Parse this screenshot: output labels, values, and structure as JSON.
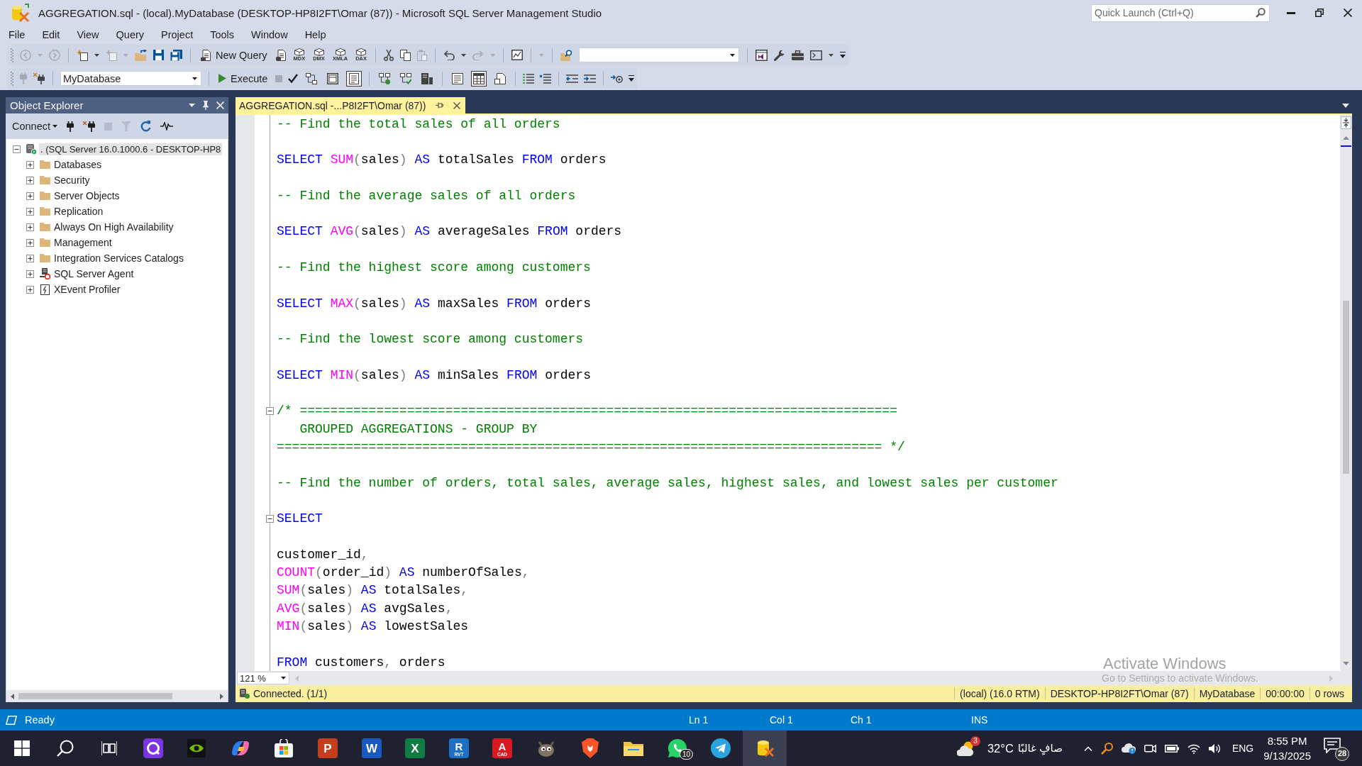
{
  "window": {
    "title": "AGGREGATION.sql - (local).MyDatabase (DESKTOP-HP8I2FT\\Omar (87)) - Microsoft SQL Server Management Studio",
    "quick_launch": {
      "placeholder": "Quick Launch (Ctrl+Q)"
    }
  },
  "menu": [
    "File",
    "Edit",
    "View",
    "Query",
    "Project",
    "Tools",
    "Window",
    "Help"
  ],
  "toolbar_1": {
    "new_query": "New Query",
    "query_types": [
      "MDX",
      "DMX",
      "XMLA",
      "DAX"
    ]
  },
  "toolbar_2": {
    "database": "MyDatabase",
    "execute": "Execute",
    "toggles": [
      {
        "on": false
      },
      {
        "on": false
      },
      {
        "on": true
      },
      {
        "on": false
      },
      {
        "on": false
      },
      {
        "on": false
      }
    ],
    "result_modes": [
      {
        "selected": false
      },
      {
        "selected": true
      },
      {
        "selected": false
      }
    ]
  },
  "object_explorer": {
    "title": "Object Explorer",
    "connect": "Connect",
    "tree": [
      {
        "label": ". (SQL Server 16.0.1000.6 - DESKTOP-HP8",
        "kind": "server",
        "expanded": true,
        "selected": true,
        "children": [
          {
            "label": "Databases",
            "kind": "folder",
            "expanded": false,
            "selected": false
          },
          {
            "label": "Security",
            "kind": "folder",
            "expanded": false,
            "selected": false
          },
          {
            "label": "Server Objects",
            "kind": "folder",
            "expanded": false,
            "selected": false
          },
          {
            "label": "Replication",
            "kind": "folder",
            "expanded": false,
            "selected": false
          },
          {
            "label": "Always On High Availability",
            "kind": "folder",
            "expanded": false,
            "selected": false
          },
          {
            "label": "Management",
            "kind": "folder",
            "expanded": false,
            "selected": false
          },
          {
            "label": "Integration Services Catalogs",
            "kind": "folder",
            "expanded": false,
            "selected": false
          },
          {
            "label": "SQL Server Agent",
            "kind": "agent",
            "expanded": false,
            "selected": false
          },
          {
            "label": "XEvent Profiler",
            "kind": "profiler",
            "expanded": false,
            "selected": false
          }
        ]
      }
    ]
  },
  "editor": {
    "tab": {
      "title": "AGGREGATION.sql -...P8I2FT\\Omar (87))",
      "selected": true
    },
    "lines": [
      {
        "kind": "code",
        "tokens": [
          {
            "kind": "comment",
            "text": "-- Find the total sales of all orders"
          }
        ]
      },
      {
        "kind": "blank"
      },
      {
        "kind": "code",
        "tokens": [
          {
            "kind": "keyword",
            "text": "SELECT "
          },
          {
            "kind": "function",
            "text": "SUM"
          },
          {
            "kind": "punct",
            "text": "("
          },
          {
            "kind": "plain",
            "text": "sales"
          },
          {
            "kind": "punct",
            "text": ") "
          },
          {
            "kind": "keyword",
            "text": "AS"
          },
          {
            "kind": "plain",
            "text": " totalSales "
          },
          {
            "kind": "keyword",
            "text": "FROM"
          },
          {
            "kind": "plain",
            "text": " orders"
          }
        ]
      },
      {
        "kind": "blank"
      },
      {
        "kind": "code",
        "tokens": [
          {
            "kind": "comment",
            "text": "-- Find the average sales of all orders"
          }
        ]
      },
      {
        "kind": "blank"
      },
      {
        "kind": "code",
        "tokens": [
          {
            "kind": "keyword",
            "text": "SELECT "
          },
          {
            "kind": "function",
            "text": "AVG"
          },
          {
            "kind": "punct",
            "text": "("
          },
          {
            "kind": "plain",
            "text": "sales"
          },
          {
            "kind": "punct",
            "text": ") "
          },
          {
            "kind": "keyword",
            "text": "AS"
          },
          {
            "kind": "plain",
            "text": " averageSales "
          },
          {
            "kind": "keyword",
            "text": "FROM"
          },
          {
            "kind": "plain",
            "text": " orders"
          }
        ]
      },
      {
        "kind": "blank"
      },
      {
        "kind": "code",
        "tokens": [
          {
            "kind": "comment",
            "text": "-- Find the highest score among customers"
          }
        ]
      },
      {
        "kind": "blank"
      },
      {
        "kind": "code",
        "tokens": [
          {
            "kind": "keyword",
            "text": "SELECT "
          },
          {
            "kind": "function",
            "text": "MAX"
          },
          {
            "kind": "punct",
            "text": "("
          },
          {
            "kind": "plain",
            "text": "sales"
          },
          {
            "kind": "punct",
            "text": ") "
          },
          {
            "kind": "keyword",
            "text": "AS"
          },
          {
            "kind": "plain",
            "text": " maxSales "
          },
          {
            "kind": "keyword",
            "text": "FROM"
          },
          {
            "kind": "plain",
            "text": " orders"
          }
        ]
      },
      {
        "kind": "blank"
      },
      {
        "kind": "code",
        "tokens": [
          {
            "kind": "comment",
            "text": "-- Find the lowest score among customers"
          }
        ]
      },
      {
        "kind": "blank"
      },
      {
        "kind": "code",
        "tokens": [
          {
            "kind": "keyword",
            "text": "SELECT "
          },
          {
            "kind": "function",
            "text": "MIN"
          },
          {
            "kind": "punct",
            "text": "("
          },
          {
            "kind": "plain",
            "text": "sales"
          },
          {
            "kind": "punct",
            "text": ") "
          },
          {
            "kind": "keyword",
            "text": "AS"
          },
          {
            "kind": "plain",
            "text": " minSales "
          },
          {
            "kind": "keyword",
            "text": "FROM"
          },
          {
            "kind": "plain",
            "text": " orders"
          }
        ]
      },
      {
        "kind": "blank"
      },
      {
        "kind": "fold",
        "expanded": true,
        "tokens": [
          {
            "kind": "comment",
            "text": "/* =============================================================================="
          }
        ]
      },
      {
        "kind": "code",
        "tokens": [
          {
            "kind": "comment",
            "text": "   GROUPED AGGREGATIONS - GROUP BY"
          }
        ]
      },
      {
        "kind": "code",
        "tokens": [
          {
            "kind": "comment",
            "text": "=============================================================================== */"
          }
        ]
      },
      {
        "kind": "blank"
      },
      {
        "kind": "code",
        "tokens": [
          {
            "kind": "comment",
            "text": "-- Find the number of orders, total sales, average sales, highest sales, and lowest sales per customer"
          }
        ]
      },
      {
        "kind": "blank"
      },
      {
        "kind": "fold",
        "expanded": true,
        "tokens": [
          {
            "kind": "keyword",
            "text": "SELECT"
          }
        ]
      },
      {
        "kind": "blank"
      },
      {
        "kind": "code",
        "tokens": [
          {
            "kind": "plain",
            "text": "customer_id"
          },
          {
            "kind": "punct",
            "text": ","
          }
        ]
      },
      {
        "kind": "code",
        "tokens": [
          {
            "kind": "function",
            "text": "COUNT"
          },
          {
            "kind": "punct",
            "text": "("
          },
          {
            "kind": "plain",
            "text": "order_id"
          },
          {
            "kind": "punct",
            "text": ") "
          },
          {
            "kind": "keyword",
            "text": "AS"
          },
          {
            "kind": "plain",
            "text": " numberOfSales"
          },
          {
            "kind": "punct",
            "text": ","
          }
        ]
      },
      {
        "kind": "code",
        "tokens": [
          {
            "kind": "function",
            "text": "SUM"
          },
          {
            "kind": "punct",
            "text": "("
          },
          {
            "kind": "plain",
            "text": "sales"
          },
          {
            "kind": "punct",
            "text": ") "
          },
          {
            "kind": "keyword",
            "text": "AS"
          },
          {
            "kind": "plain",
            "text": " totalSales"
          },
          {
            "kind": "punct",
            "text": ","
          }
        ]
      },
      {
        "kind": "code",
        "tokens": [
          {
            "kind": "function",
            "text": "AVG"
          },
          {
            "kind": "punct",
            "text": "("
          },
          {
            "kind": "plain",
            "text": "sales"
          },
          {
            "kind": "punct",
            "text": ") "
          },
          {
            "kind": "keyword",
            "text": "AS"
          },
          {
            "kind": "plain",
            "text": " avgSales"
          },
          {
            "kind": "punct",
            "text": ","
          }
        ]
      },
      {
        "kind": "code",
        "tokens": [
          {
            "kind": "function",
            "text": "MIN"
          },
          {
            "kind": "punct",
            "text": "("
          },
          {
            "kind": "plain",
            "text": "sales"
          },
          {
            "kind": "punct",
            "text": ") "
          },
          {
            "kind": "keyword",
            "text": "AS"
          },
          {
            "kind": "plain",
            "text": " lowestSales"
          }
        ]
      },
      {
        "kind": "blank"
      },
      {
        "kind": "code",
        "tokens": [
          {
            "kind": "keyword",
            "text": "FROM"
          },
          {
            "kind": "plain",
            "text": " customers"
          },
          {
            "kind": "punct",
            "text": ", "
          },
          {
            "kind": "plain",
            "text": "orders"
          }
        ]
      }
    ],
    "zoom": "121 %"
  },
  "activation_notice": {
    "title": "Activate Windows",
    "message": "Go to Settings to activate Windows."
  },
  "query_status": {
    "message": "Connected. (1/1)",
    "fields": [
      "(local) (16.0 RTM)",
      "DESKTOP-HP8I2FT\\Omar (87)",
      "MyDatabase",
      "00:00:00",
      "0 rows"
    ]
  },
  "status_bar": {
    "message": "Ready",
    "fields": [
      "Ln 1",
      "Col 1",
      "Ch 1",
      "INS"
    ]
  },
  "taskbar": {
    "apps": [
      {
        "selected": false
      },
      {
        "selected": false
      },
      {
        "selected": false
      },
      {
        "selected": false
      },
      {
        "selected": false,
        "glyph": "P"
      },
      {
        "selected": false,
        "glyph": "W"
      },
      {
        "selected": false,
        "glyph": "X"
      },
      {
        "selected": false,
        "glyph": "R",
        "caption": "RVT"
      },
      {
        "selected": false,
        "glyph": "A",
        "caption": "CAD"
      },
      {
        "selected": false
      },
      {
        "selected": false
      },
      {
        "selected": false
      },
      {
        "selected": false,
        "badge": "10"
      },
      {
        "selected": false
      },
      {
        "selected": true
      }
    ],
    "weather": {
      "badge": "3",
      "temperature": "32°C",
      "condition": "صافٍ غالبًا"
    },
    "language": "ENG",
    "time": "8:55 PM",
    "date": "9/13/2025",
    "notifications": "28"
  }
}
